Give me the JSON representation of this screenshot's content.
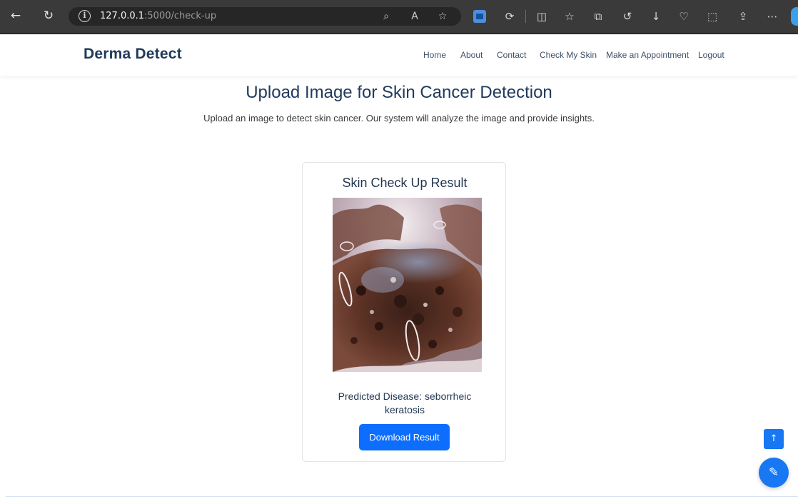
{
  "browser": {
    "url_host": "127.0.0.1",
    "url_path": ":5000/check-up",
    "icons": {
      "back": "back-arrow-icon",
      "refresh": "refresh-icon",
      "site_info": "info-icon"
    }
  },
  "site": {
    "brand": "Derma Detect",
    "nav": [
      "Home",
      "About",
      "Contact",
      "Check My Skin",
      "Make an Appointment",
      "Logout"
    ]
  },
  "main": {
    "heading": "Upload Image for Skin Cancer Detection",
    "subtext": "Upload an image to detect skin cancer. Our system will analyze the image and provide insights."
  },
  "result": {
    "title": "Skin Check Up Result",
    "prediction_line1": "Predicted Disease: seborrheic",
    "prediction_line2": "keratosis",
    "download_label": "Download Result"
  },
  "colors": {
    "brand": "#1f3a5a",
    "primary": "#0d6efd",
    "fab": "#1877f2"
  }
}
